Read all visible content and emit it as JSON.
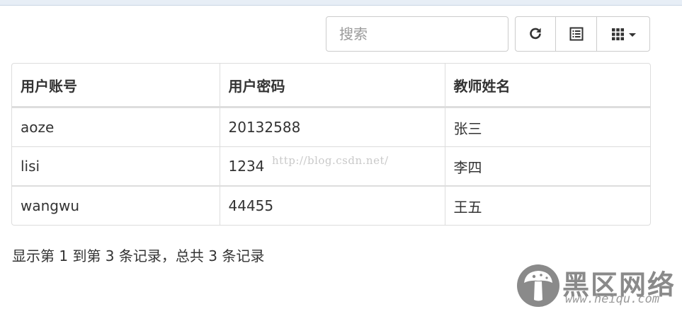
{
  "toolbar": {
    "search_placeholder": "搜索",
    "buttons": [
      {
        "icon": "refresh-icon"
      },
      {
        "icon": "list-toggle-icon"
      },
      {
        "icon": "columns-grid-icon"
      }
    ]
  },
  "table": {
    "headers": [
      "用户账号",
      "用户密码",
      "教师姓名"
    ],
    "rows": [
      [
        "aoze",
        "20132588",
        "张三"
      ],
      [
        "lisi",
        "1234",
        "李四"
      ],
      [
        "wangwu",
        "44455",
        "王五"
      ]
    ]
  },
  "watermark": "http://blog.csdn.net/",
  "pagination": {
    "info": "显示第 1 到第 3 条记录，总共 3 条记录"
  },
  "logo": {
    "text": "黑区网络",
    "url": "www.heiqu.com"
  },
  "colors": {
    "border": "#dddddd",
    "text": "#333333",
    "top_strip": "#e7eef6"
  }
}
